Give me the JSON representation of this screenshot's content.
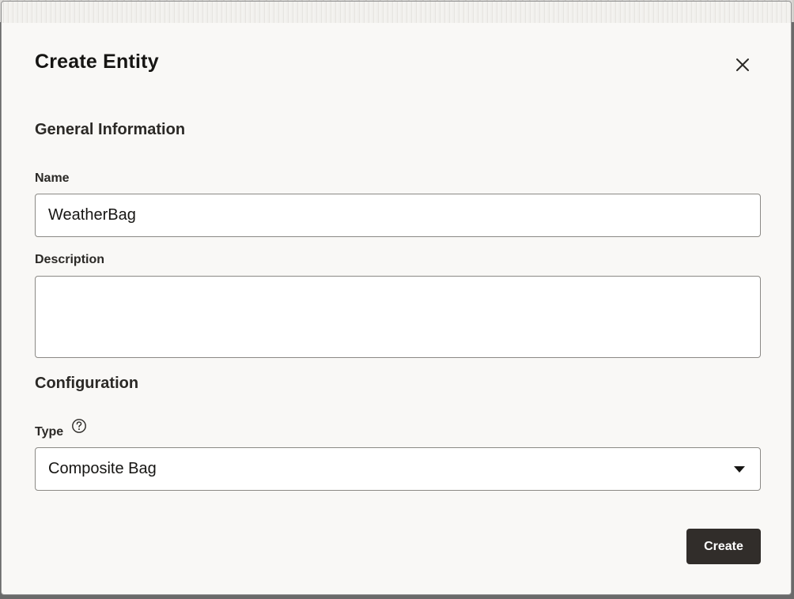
{
  "dialog": {
    "title": "Create Entity",
    "close_icon": "close-icon"
  },
  "general_section": {
    "heading": "General Information",
    "name_label": "Name",
    "name_value": "WeatherBag",
    "description_label": "Description",
    "description_value": ""
  },
  "configuration_section": {
    "heading": "Configuration",
    "type_label": "Type",
    "help_icon": "help-circle-icon",
    "type_value": "Composite Bag",
    "dropdown_icon": "chevron-down-icon"
  },
  "actions": {
    "create_label": "Create"
  },
  "colors": {
    "dialog_background": "#f9f8f6",
    "primary_button": "#312d2a",
    "text": "#161513"
  }
}
